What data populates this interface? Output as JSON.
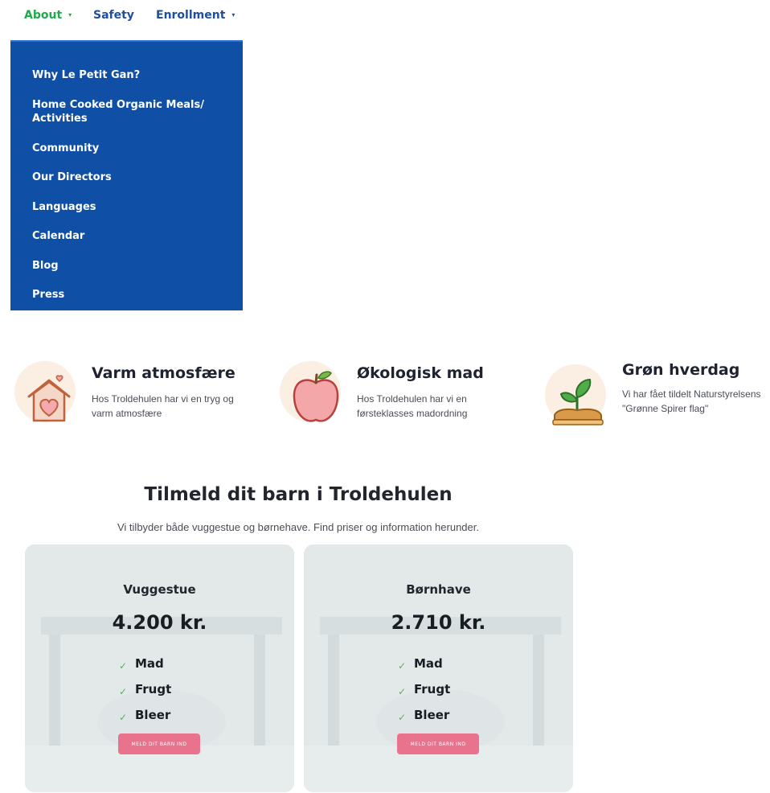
{
  "nav": {
    "items": [
      {
        "label": "About",
        "has_caret": true
      },
      {
        "label": "Safety",
        "has_caret": false
      },
      {
        "label": "Enrollment",
        "has_caret": true
      }
    ],
    "caret": "▾",
    "active_color": "#1eaa4b",
    "link_color": "#1e4fa0"
  },
  "dropdown": {
    "background": "#0f4fa6",
    "items": [
      "Why Le Petit Gan?",
      "Home Cooked Organic Meals/ Activities",
      "Community",
      "Our Directors",
      "Languages",
      "Calendar",
      "Blog",
      "Press"
    ]
  },
  "features": [
    {
      "icon": "house-heart-icon",
      "title": "Varm atmosfære",
      "text": "Hos Troldehulen har vi en tryg og varm atmosfære"
    },
    {
      "icon": "apple-icon",
      "title": "Økologisk mad",
      "text": "Hos Troldehulen har vi en førsteklasses madordning"
    },
    {
      "icon": "sprout-icon",
      "title": "Grøn hverdag",
      "text": "Vi har fået tildelt Naturstyrelsens \"Grønne Spirer flag\""
    }
  ],
  "enroll": {
    "title": "Tilmeld dit barn i Troldehulen",
    "subtitle": "Vi tilbyder både vuggestue og børnehave. Find priser og information herunder.",
    "cards": [
      {
        "name": "Vuggestue",
        "price": "4.200 kr.",
        "items": [
          "Mad",
          "Frugt",
          "Bleer"
        ],
        "button": "MELD DIT BARN IND"
      },
      {
        "name": "Børnhave",
        "price": "2.710 kr.",
        "items": [
          "Mad",
          "Frugt",
          "Bleer"
        ],
        "button": "MELD DIT BARN IND"
      }
    ],
    "check_glyph": "✓",
    "button_color": "#e9728c"
  }
}
